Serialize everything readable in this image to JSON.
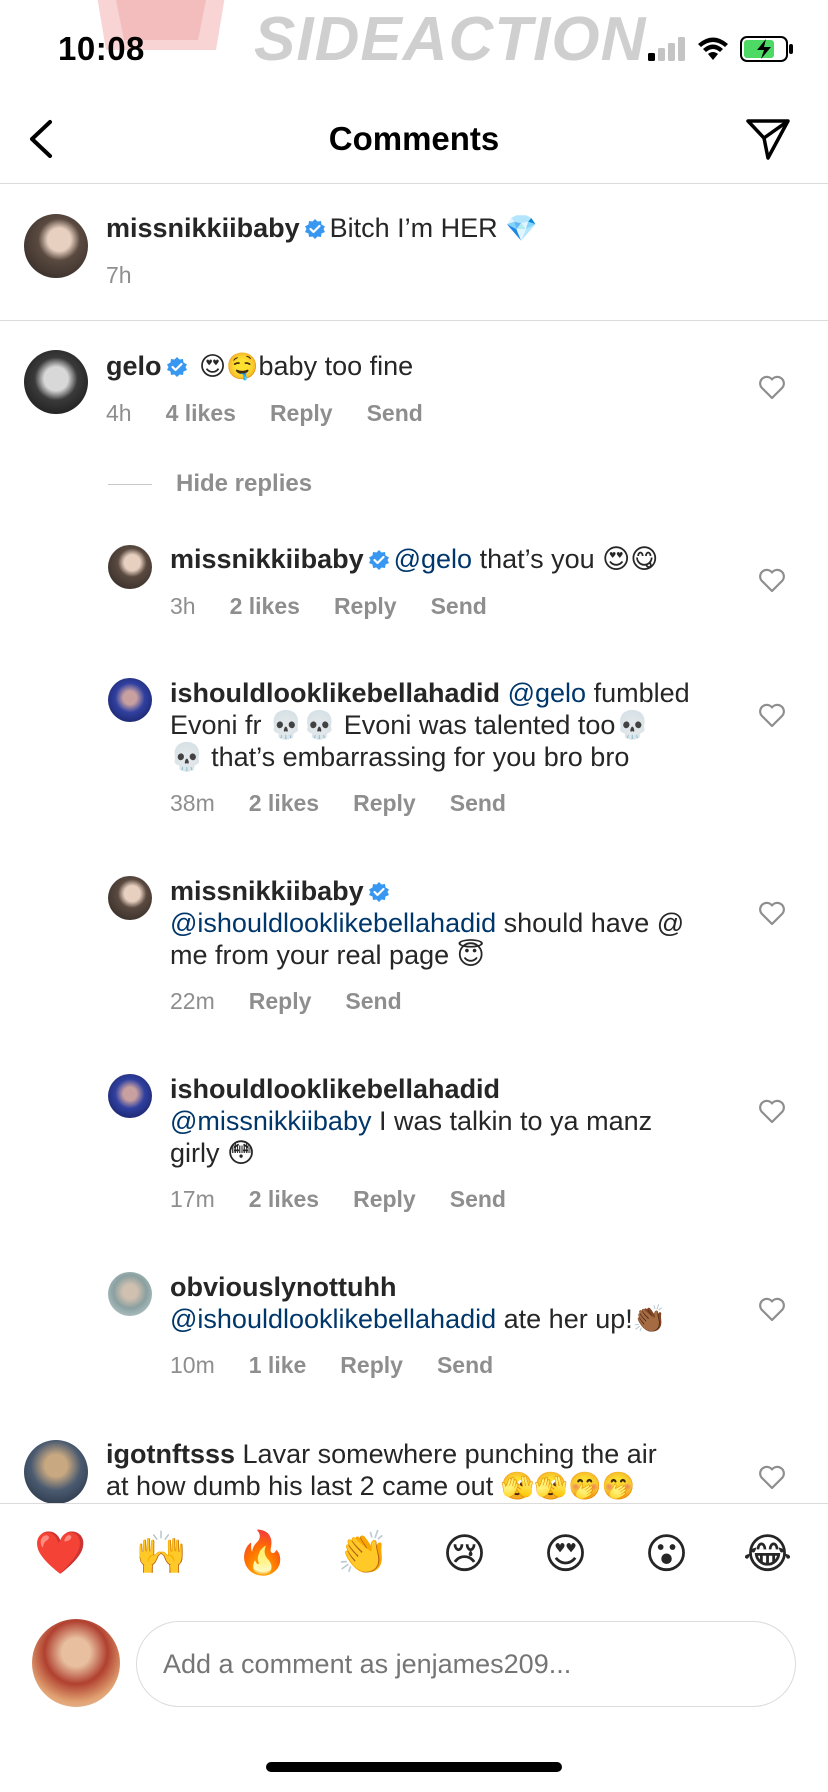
{
  "status": {
    "time": "10:08",
    "watermark": "SIDEACTION"
  },
  "nav": {
    "title": "Comments"
  },
  "caption": {
    "username": "missnikkiibaby",
    "text": "Bitch I’m HER",
    "emoji": "💎",
    "time": "7h"
  },
  "comments": [
    {
      "username": "gelo",
      "prefix": "😍🤤",
      "text": "baby too fine",
      "time": "4h",
      "likes": "4 likes",
      "reply": "Reply",
      "send": "Send"
    },
    {
      "username": "missnikkiibaby",
      "mention": "@gelo",
      "text": "that’s you 😍😋",
      "time": "3h",
      "likes": "2 likes",
      "reply": "Reply",
      "send": "Send"
    },
    {
      "username": "ishouldlooklikebellahadid",
      "mention": "@gelo",
      "text_line1": "fumbled",
      "text_line2": "Evoni fr 💀💀 Evoni was talented too💀",
      "text_line3": "💀 that’s embarrassing for you bro bro",
      "time": "38m",
      "likes": "2 likes",
      "reply": "Reply",
      "send": "Send"
    },
    {
      "username": "missnikkiibaby",
      "mention": "@ishouldlooklikebellahadid",
      "text_line1": "should have @",
      "text_line2": "me from your real page 😇",
      "time": "22m",
      "reply": "Reply",
      "send": "Send"
    },
    {
      "username": "ishouldlooklikebellahadid",
      "mention": "@missnikkiibaby",
      "text_line1": "I was talkin to ya manz",
      "text_line2": "girly 😳",
      "time": "17m",
      "likes": "2 likes",
      "reply": "Reply",
      "send": "Send"
    },
    {
      "username": "obviouslynottuhh",
      "mention": "@ishouldlooklikebellahadid",
      "text": "ate her up!👏🏾",
      "time": "10m",
      "likes": "1 like",
      "reply": "Reply",
      "send": "Send"
    },
    {
      "username": "igotnftsss",
      "text_line1": "Lavar somewhere punching the air",
      "text_line2": "at how dumb his last 2 came out 🫣🫣🤭🤭"
    }
  ],
  "hide_replies": "Hide replies",
  "reactions": [
    "❤️",
    "🙌",
    "🔥",
    "👏",
    "😢",
    "😍",
    "😮",
    "😂"
  ],
  "composer": {
    "placeholder": "Add a comment as jenjames209..."
  },
  "colors": {
    "mention": "#00376b",
    "verified": "#3897f0",
    "muted": "#8e8e8e",
    "divider": "#dbdbdb"
  }
}
